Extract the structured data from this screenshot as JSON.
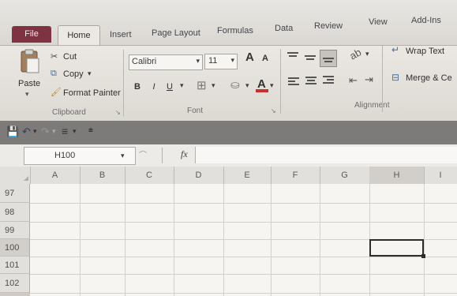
{
  "tabs": [
    "File",
    "Home",
    "Insert",
    "Page Layout",
    "Formulas",
    "Data",
    "Review",
    "View",
    "Add-Ins"
  ],
  "clipboard": {
    "paste": "Paste",
    "cut": "Cut",
    "copy": "Copy",
    "format_painter": "Format Painter",
    "group": "Clipboard"
  },
  "font": {
    "name": "Calibri",
    "size": "11",
    "bold": "B",
    "italic": "I",
    "underline": "U",
    "group": "Font"
  },
  "alignment": {
    "wrap_text": "Wrap Text",
    "merge": "Merge & Ce",
    "group": "Alignment"
  },
  "formula_bar": {
    "name_box": "H100",
    "fx": "fx",
    "value": ""
  },
  "columns": [
    "A",
    "B",
    "C",
    "D",
    "E",
    "F",
    "G",
    "H",
    "I"
  ],
  "rows": [
    "97",
    "98",
    "99",
    "100",
    "101",
    "102"
  ],
  "selected_cell": "H100",
  "colors": {
    "file_tab": "#7f3241",
    "qat_bar": "#7d7b79",
    "selection_border": "#2d2d2d"
  }
}
